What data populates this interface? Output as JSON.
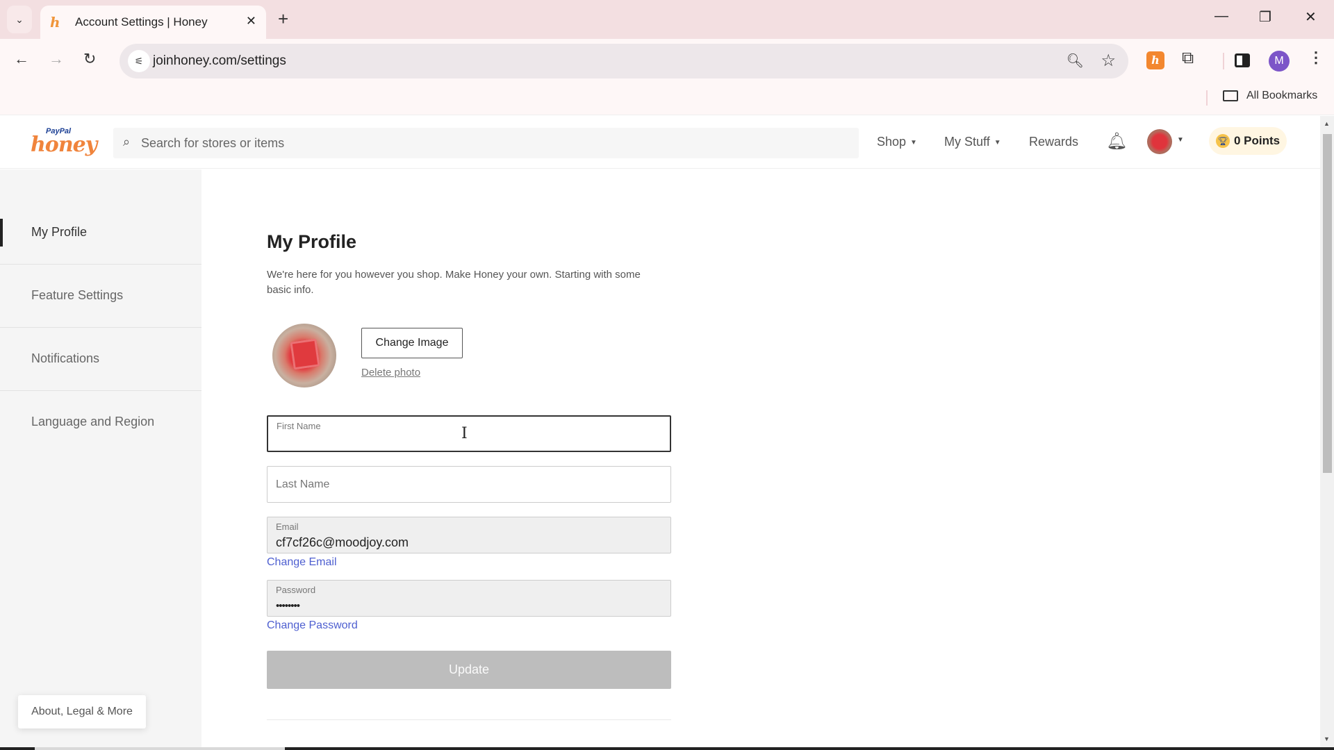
{
  "browser": {
    "tab": {
      "title": "Account Settings | Honey",
      "favicon": "honey-favicon"
    },
    "new_tab_symbol": "+",
    "tab_close_symbol": "✕",
    "tab_list_symbol": "⌄",
    "window_controls": {
      "minimize": "—",
      "restore": "❐",
      "close": "✕"
    },
    "nav": {
      "back": "←",
      "forward": "→",
      "reload": "↻"
    },
    "url": "joinhoney.com/settings",
    "icons": {
      "site_info": "⚟",
      "zoom": "🔍︎",
      "bookmark_star": "☆",
      "extensions": "⧉",
      "menu": "⋮"
    },
    "profile_initial": "M",
    "honey_extension_glyph": "h",
    "bookmarks_bar": {
      "all_bookmarks": "All Bookmarks"
    }
  },
  "site_header": {
    "logo": {
      "paypal": "PayPal",
      "honey": "honey"
    },
    "search": {
      "placeholder": "Search for stores or items",
      "icon": "⌕"
    },
    "nav": [
      {
        "label": "Shop",
        "has_dropdown": true
      },
      {
        "label": "My Stuff",
        "has_dropdown": true
      },
      {
        "label": "Rewards",
        "has_dropdown": false
      }
    ],
    "caret": "▼",
    "bell_icon": "🔔︎",
    "points": {
      "label": "0 Points",
      "trophy": "🏆︎"
    }
  },
  "sidebar": {
    "items": [
      {
        "label": "My Profile",
        "active": true
      },
      {
        "label": "Feature Settings",
        "active": false
      },
      {
        "label": "Notifications",
        "active": false
      },
      {
        "label": "Language and Region",
        "active": false
      }
    ],
    "footer_button": "About, Legal & More"
  },
  "profile": {
    "title": "My Profile",
    "description": "We're here for you however you shop. Make Honey your own. Starting with some basic info.",
    "change_image_label": "Change Image",
    "delete_photo_label": "Delete photo",
    "fields": {
      "first_name": {
        "label": "First Name",
        "value": ""
      },
      "last_name": {
        "label": "Last Name",
        "value": ""
      },
      "email": {
        "label": "Email",
        "value": "cf7cf26c@moodjoy.com"
      },
      "password": {
        "label": "Password",
        "value": "••••••••"
      }
    },
    "change_email_label": "Change Email",
    "change_password_label": "Change Password",
    "update_label": "Update"
  },
  "scrollbar": {
    "up": "▲",
    "down": "▼"
  },
  "colors": {
    "brand_orange": "#f0843c",
    "link_blue": "#4e5fd0",
    "update_disabled": "#bdbdbd",
    "points_bg": "#fff6e2",
    "tabstrip_bg": "#f3dfe1"
  }
}
